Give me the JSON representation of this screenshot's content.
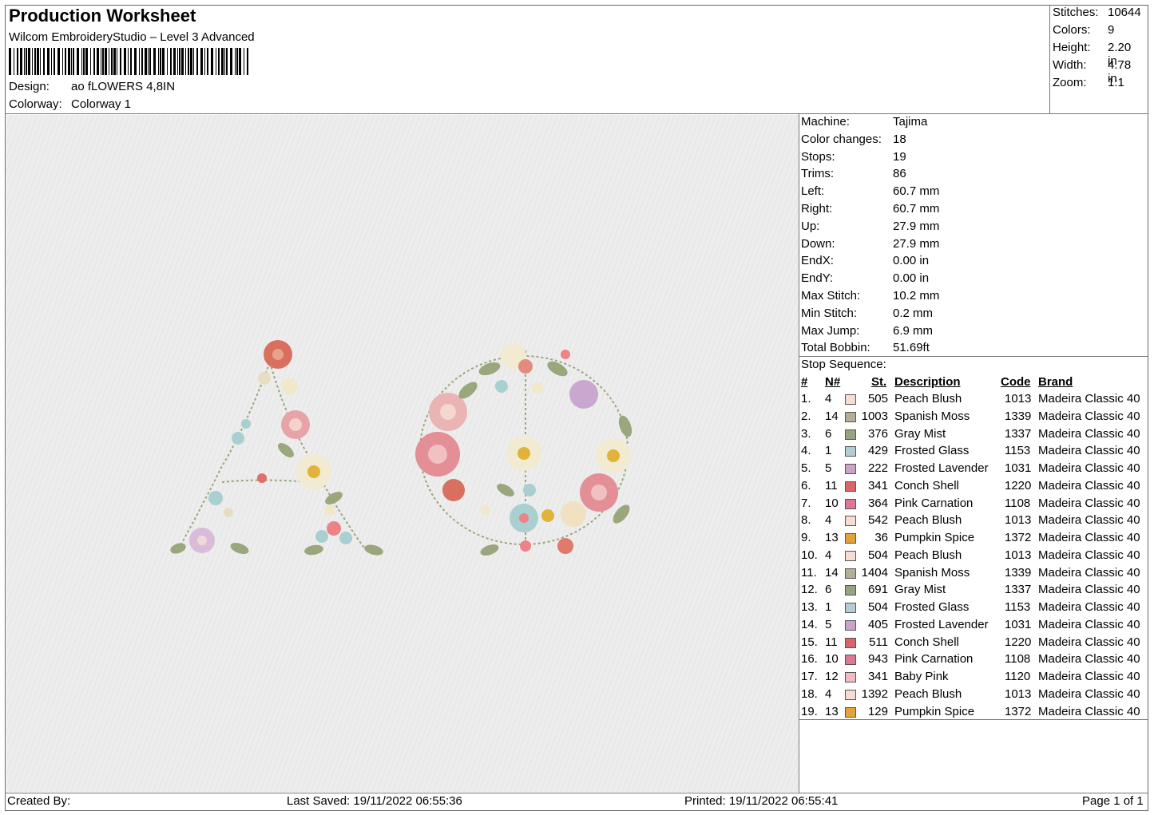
{
  "header": {
    "title": "Production Worksheet",
    "subtitle": "Wilcom EmbroideryStudio – Level 3 Advanced",
    "design_label": "Design:",
    "design_value": "ao fLOWERS 4,8IN",
    "colorway_label": "Colorway:",
    "colorway_value": "Colorway 1"
  },
  "stats": [
    {
      "label": "Stitches:",
      "value": "10644"
    },
    {
      "label": "Colors:",
      "value": "9"
    },
    {
      "label": "Height:",
      "value": "2.20 in"
    },
    {
      "label": "Width:",
      "value": "4.78 in"
    },
    {
      "label": "Zoom:",
      "value": "1:1"
    }
  ],
  "machine_info": [
    {
      "label": "Machine:",
      "value": "Tajima"
    },
    {
      "label": "Color changes:",
      "value": "18"
    },
    {
      "label": "Stops:",
      "value": "19"
    },
    {
      "label": "Trims:",
      "value": "86"
    },
    {
      "label": "Left:",
      "value": "60.7 mm"
    },
    {
      "label": "Right:",
      "value": "60.7 mm"
    },
    {
      "label": "Up:",
      "value": "27.9 mm"
    },
    {
      "label": "Down:",
      "value": "27.9 mm"
    },
    {
      "label": "EndX:",
      "value": "0.00 in"
    },
    {
      "label": "EndY:",
      "value": "0.00 in"
    },
    {
      "label": "Max Stitch:",
      "value": "10.2 mm"
    },
    {
      "label": "Min Stitch:",
      "value": "0.2 mm"
    },
    {
      "label": "Max Jump:",
      "value": "6.9 mm"
    },
    {
      "label": "Total Bobbin:",
      "value": "51.69ft"
    }
  ],
  "stop_sequence": {
    "title": "Stop Sequence:",
    "headers": {
      "idx": "#",
      "needle": "N#",
      "stitches": "St.",
      "description": "Description",
      "code": "Code",
      "brand": "Brand"
    },
    "rows": [
      {
        "idx": "1.",
        "needle": "4",
        "color": "#f8dcd2",
        "stitches": "505",
        "description": "Peach Blush",
        "code": "1013",
        "brand": "Madeira Classic 40"
      },
      {
        "idx": "2.",
        "needle": "14",
        "color": "#b3ae96",
        "stitches": "1003",
        "description": "Spanish Moss",
        "code": "1339",
        "brand": "Madeira Classic 40"
      },
      {
        "idx": "3.",
        "needle": "6",
        "color": "#97a27f",
        "stitches": "376",
        "description": "Gray Mist",
        "code": "1337",
        "brand": "Madeira Classic 40"
      },
      {
        "idx": "4.",
        "needle": "1",
        "color": "#b4ccd6",
        "stitches": "429",
        "description": "Frosted Glass",
        "code": "1153",
        "brand": "Madeira Classic 40"
      },
      {
        "idx": "5.",
        "needle": "5",
        "color": "#cda2c8",
        "stitches": "222",
        "description": "Frosted Lavender",
        "code": "1031",
        "brand": "Madeira Classic 40"
      },
      {
        "idx": "6.",
        "needle": "11",
        "color": "#d9646a",
        "stitches": "341",
        "description": "Conch Shell",
        "code": "1220",
        "brand": "Madeira Classic 40"
      },
      {
        "idx": "7.",
        "needle": "10",
        "color": "#de7793",
        "stitches": "364",
        "description": "Pink Carnation",
        "code": "1108",
        "brand": "Madeira Classic 40"
      },
      {
        "idx": "8.",
        "needle": "4",
        "color": "#f8dcd2",
        "stitches": "542",
        "description": "Peach Blush",
        "code": "1013",
        "brand": "Madeira Classic 40"
      },
      {
        "idx": "9.",
        "needle": "13",
        "color": "#e5a23c",
        "stitches": "36",
        "description": "Pumpkin Spice",
        "code": "1372",
        "brand": "Madeira Classic 40"
      },
      {
        "idx": "10.",
        "needle": "4",
        "color": "#f8dcd2",
        "stitches": "504",
        "description": "Peach Blush",
        "code": "1013",
        "brand": "Madeira Classic 40"
      },
      {
        "idx": "11.",
        "needle": "14",
        "color": "#b3ae96",
        "stitches": "1404",
        "description": "Spanish Moss",
        "code": "1339",
        "brand": "Madeira Classic 40"
      },
      {
        "idx": "12.",
        "needle": "6",
        "color": "#97a27f",
        "stitches": "691",
        "description": "Gray Mist",
        "code": "1337",
        "brand": "Madeira Classic 40"
      },
      {
        "idx": "13.",
        "needle": "1",
        "color": "#b4ccd6",
        "stitches": "504",
        "description": "Frosted Glass",
        "code": "1153",
        "brand": "Madeira Classic 40"
      },
      {
        "idx": "14.",
        "needle": "5",
        "color": "#cda2c8",
        "stitches": "405",
        "description": "Frosted Lavender",
        "code": "1031",
        "brand": "Madeira Classic 40"
      },
      {
        "idx": "15.",
        "needle": "11",
        "color": "#d9646a",
        "stitches": "511",
        "description": "Conch Shell",
        "code": "1220",
        "brand": "Madeira Classic 40"
      },
      {
        "idx": "16.",
        "needle": "10",
        "color": "#de7793",
        "stitches": "943",
        "description": "Pink Carnation",
        "code": "1108",
        "brand": "Madeira Classic 40"
      },
      {
        "idx": "17.",
        "needle": "12",
        "color": "#f0bcc4",
        "stitches": "341",
        "description": "Baby Pink",
        "code": "1120",
        "brand": "Madeira Classic 40"
      },
      {
        "idx": "18.",
        "needle": "4",
        "color": "#f8dcd2",
        "stitches": "1392",
        "description": "Peach Blush",
        "code": "1013",
        "brand": "Madeira Classic 40"
      },
      {
        "idx": "19.",
        "needle": "13",
        "color": "#e5a23c",
        "stitches": "129",
        "description": "Pumpkin Spice",
        "code": "1372",
        "brand": "Madeira Classic 40"
      }
    ]
  },
  "footer": {
    "created_by": "Created By:",
    "last_saved": "Last Saved: 19/11/2022 06:55:36",
    "printed": "Printed: 19/11/2022 06:55:41",
    "page": "Page 1 of 1"
  }
}
